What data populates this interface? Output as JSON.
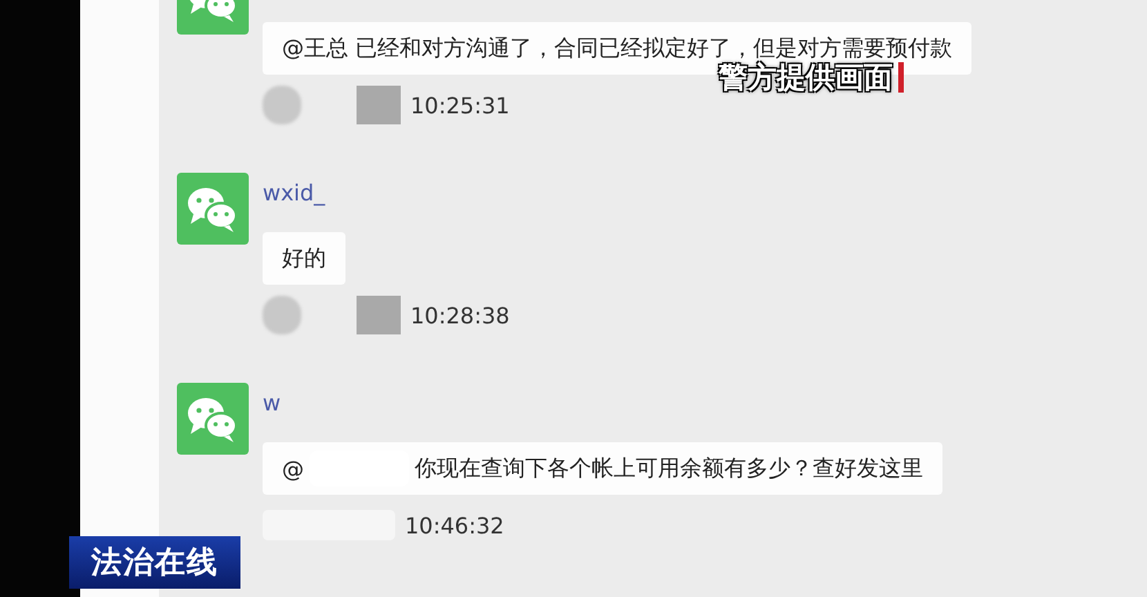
{
  "messages": [
    {
      "text": "@王总 已经和对方沟通了，合同已经拟定好了，但是对方需要预付款",
      "time": "10:25:31"
    },
    {
      "sender": "wxid_",
      "text": "好的",
      "time": "10:28:38"
    },
    {
      "sender": "w",
      "mention": "@",
      "text": "你现在查询下各个帐上可用余额有多少？查好发这里",
      "time": "10:46:32"
    }
  ],
  "overlay_caption": "警方提供画面",
  "program_logo": {
    "title": "法治在线"
  }
}
